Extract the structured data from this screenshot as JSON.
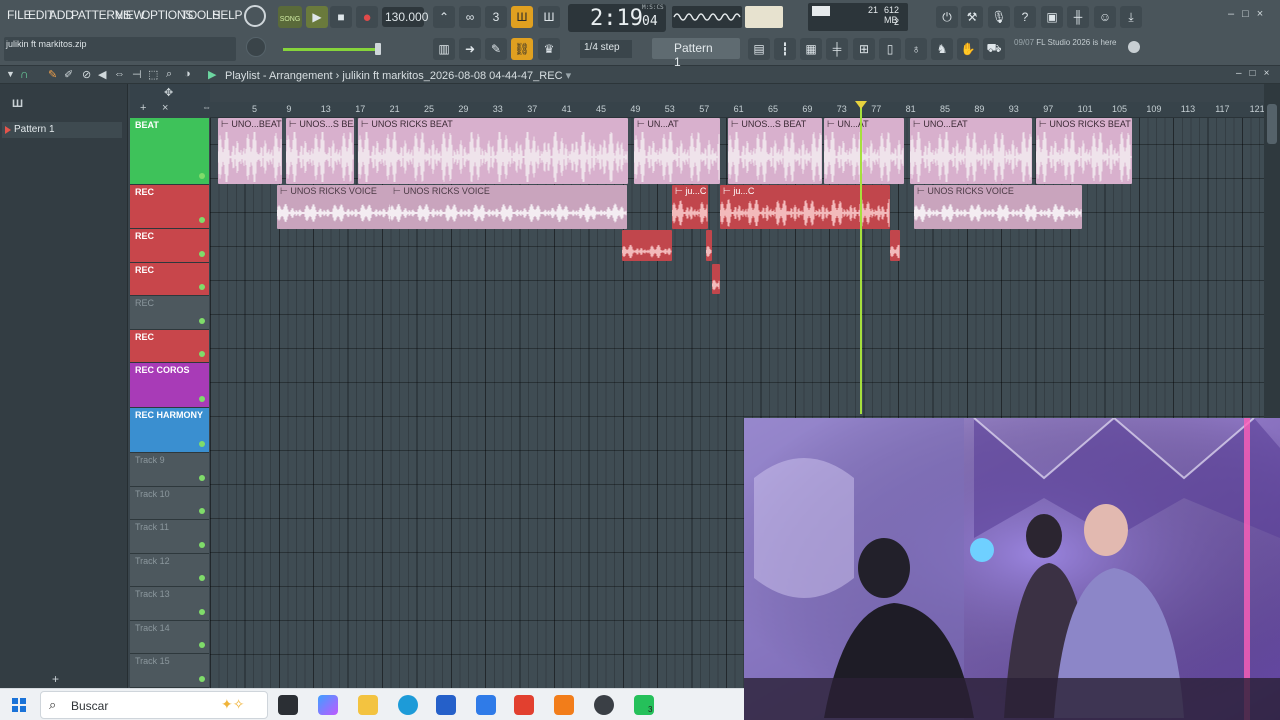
{
  "menu": [
    "FILE",
    "EDIT",
    "ADD",
    "PATTERNS",
    "VIEW",
    "OPTIONS",
    "TOOLS",
    "HELP"
  ],
  "transport": {
    "mode_label": "SONG",
    "tempo": "130.000",
    "time": "2:19",
    "time_small": "04",
    "time_units": "M:S:CS",
    "cpu_value": "21",
    "mem_value": "612 MB",
    "voices": "2"
  },
  "hint_text": "julikin ft markitos.zip",
  "snap": "1/4 step",
  "pattern_selector": "Pattern 1",
  "news": {
    "date": "09/07",
    "text": "FL Studio 2026 is here"
  },
  "playlist": {
    "title": "Playlist - Arrangement",
    "separator": "›",
    "project": "julikin ft markitos_2026-08-08 04-44-47_REC",
    "patterns": [
      "Pattern 1"
    ]
  },
  "ruler_ticks": [
    "5",
    "9",
    "13",
    "17",
    "21",
    "25",
    "29",
    "33",
    "37",
    "41",
    "45",
    "49",
    "53",
    "57",
    "61",
    "65",
    "69",
    "73",
    "77",
    "81",
    "85",
    "89",
    "93",
    "97",
    "101",
    "105",
    "109",
    "113",
    "117",
    "121"
  ],
  "tracks": [
    {
      "name": "BEAT",
      "color": "#3ec25a",
      "h": 67
    },
    {
      "name": "REC",
      "color": "#c8464b",
      "h": 44
    },
    {
      "name": "REC",
      "color": "#c8464b",
      "h": 34
    },
    {
      "name": "REC",
      "color": "#c8464b",
      "h": 33
    },
    {
      "name": "REC",
      "color": "#4d585e",
      "h": 34
    },
    {
      "name": "REC",
      "color": "#c8464b",
      "h": 33
    },
    {
      "name": "REC COROS",
      "color": "#a83bb7",
      "h": 45
    },
    {
      "name": "REC HARMONY",
      "color": "#3a8fd0",
      "h": 45
    },
    {
      "name": "Track 9",
      "color": "#4d585e",
      "h": 34
    },
    {
      "name": "Track 10",
      "color": "#4d585e",
      "h": 33
    },
    {
      "name": "Track 11",
      "color": "#4d585e",
      "h": 34
    },
    {
      "name": "Track 12",
      "color": "#4d585e",
      "h": 33
    },
    {
      "name": "Track 13",
      "color": "#4d585e",
      "h": 34
    },
    {
      "name": "Track 14",
      "color": "#4d585e",
      "h": 33
    },
    {
      "name": "Track 15",
      "color": "#4d585e",
      "h": 34
    }
  ],
  "clips": {
    "beat": [
      "UNO...BEAT",
      "UNOS...S BEAT",
      "UNOS RICKS BEAT",
      "UN...AT",
      "UNOS...S BEAT",
      "UN...AT",
      "UNO...EAT",
      "UNOS RICKS BEAT"
    ],
    "voice": [
      "UNOS RICKS VOICE",
      "UNOS RICKS VOICE",
      "ju...C",
      "ju...C",
      "UNOS RICKS VOICE"
    ]
  },
  "taskbar": {
    "search_placeholder": "Buscar",
    "badge": "3"
  }
}
